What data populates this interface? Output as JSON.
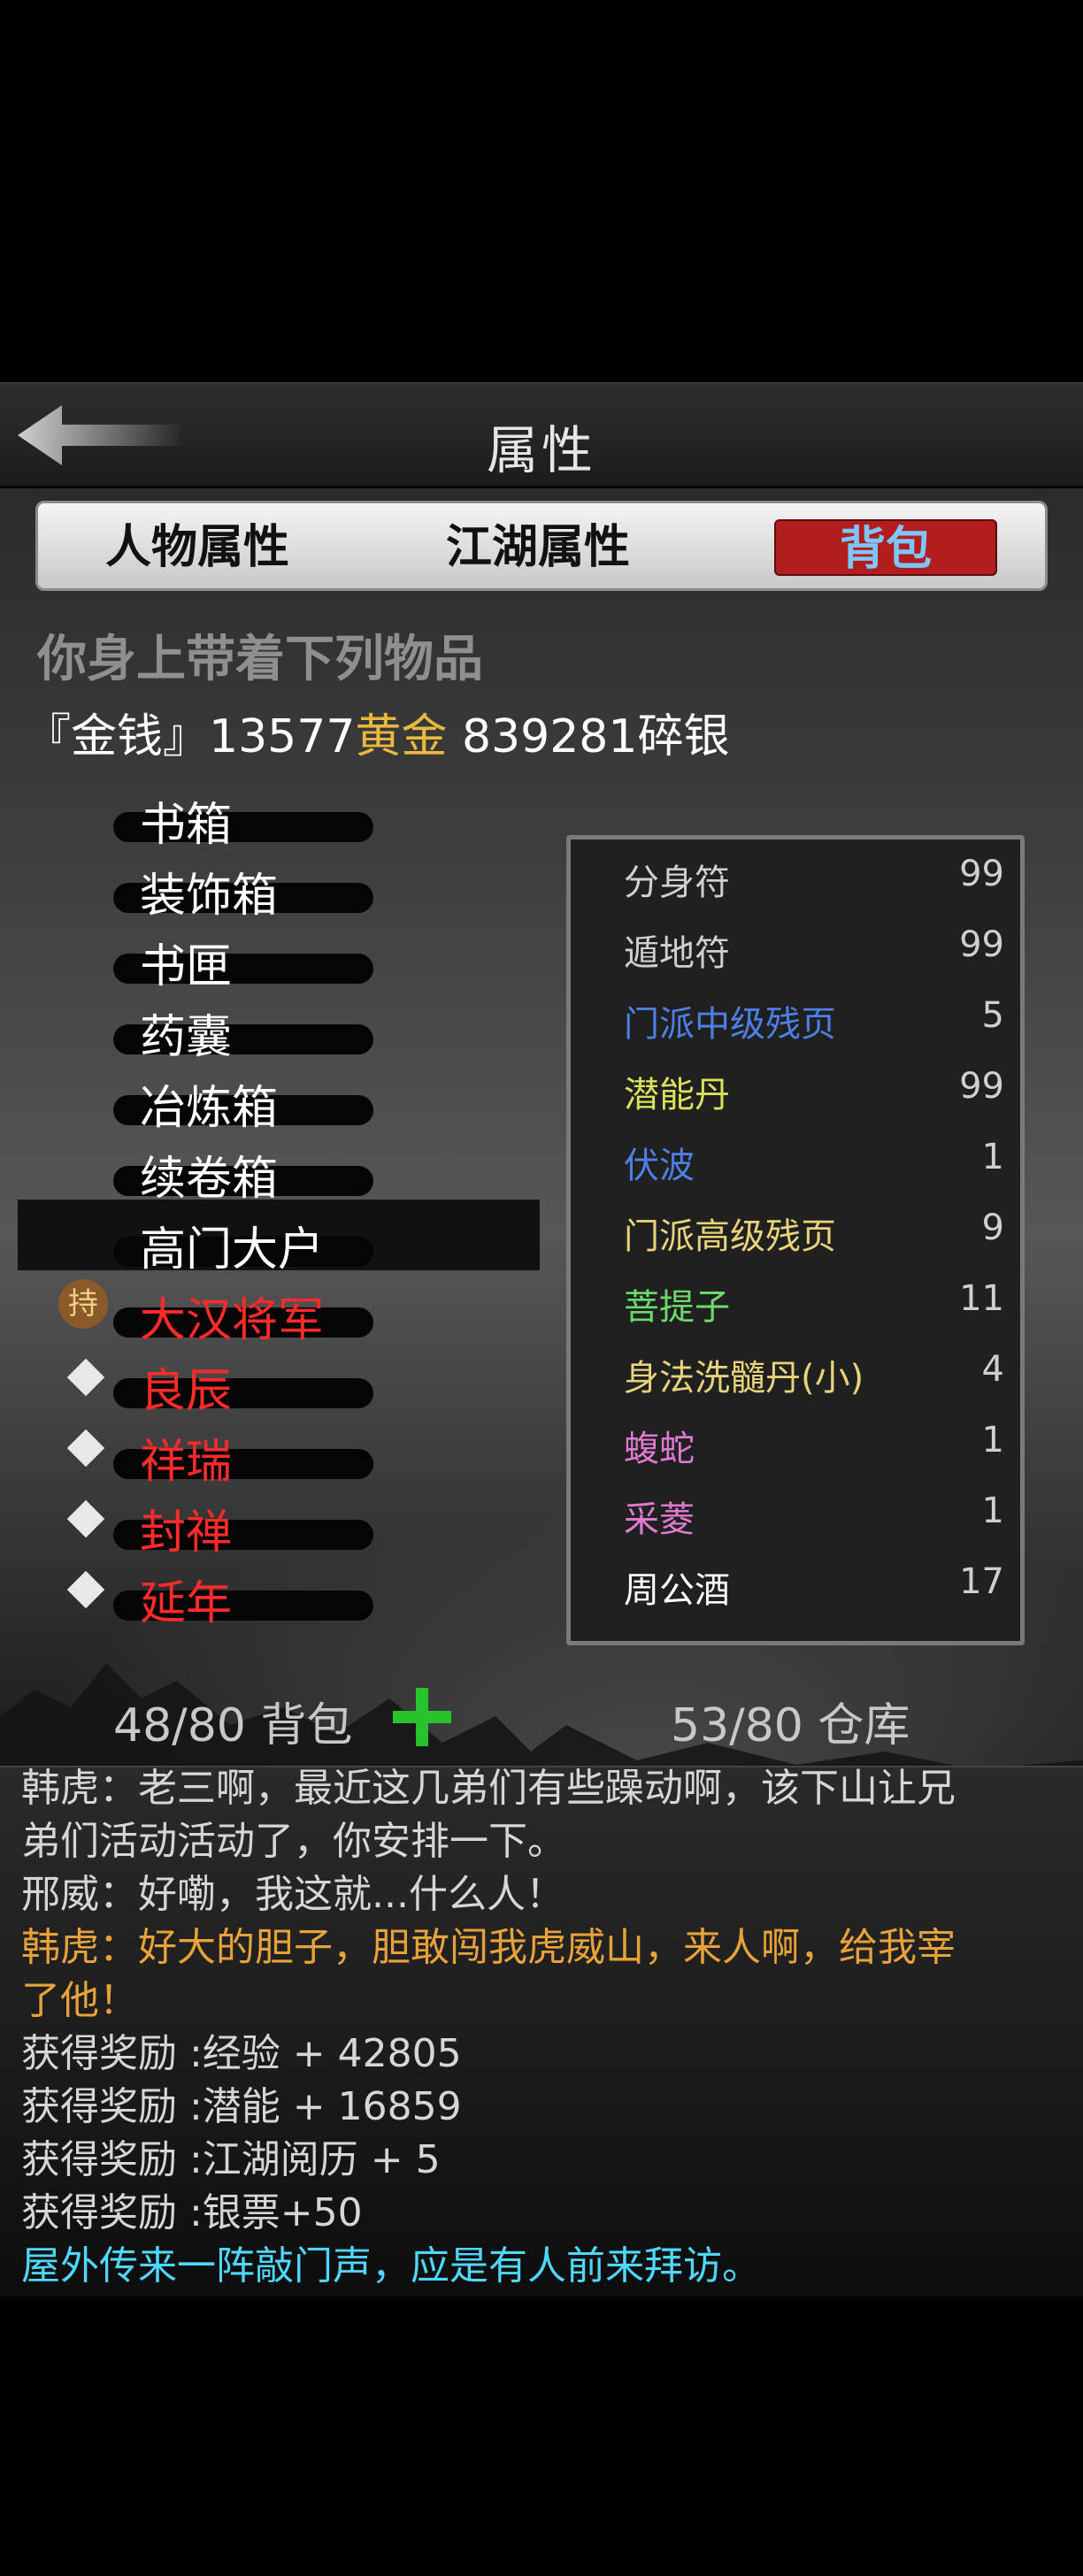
{
  "header": {
    "title": "属性",
    "back_icon": "arrow-left-icon"
  },
  "tabs": [
    {
      "label": "人物属性",
      "active": false
    },
    {
      "label": "江湖属性",
      "active": false
    },
    {
      "label": "背包",
      "active": true
    }
  ],
  "inventory": {
    "heading": "你身上带着下列物品",
    "money": {
      "prefix": "『金钱』13577",
      "gold_label": "黄金",
      "suffix": " 839281碎银"
    },
    "hold_badge": "持",
    "categories": [
      {
        "label": "书箱",
        "color": "#ffffff"
      },
      {
        "label": "装饰箱",
        "color": "#ffffff"
      },
      {
        "label": "书匣",
        "color": "#ffffff"
      },
      {
        "label": "药囊",
        "color": "#ffffff"
      },
      {
        "label": "冶炼箱",
        "color": "#ffffff"
      },
      {
        "label": "续卷箱",
        "color": "#ffffff"
      },
      {
        "label": "高门大户",
        "color": "#ffffff",
        "selected": true
      },
      {
        "label": "大汉将军",
        "color": "#ff2a2a",
        "held": true
      },
      {
        "label": "良辰",
        "color": "#ff2a2a"
      },
      {
        "label": "祥瑞",
        "color": "#ff2a2a"
      },
      {
        "label": "封禅",
        "color": "#ff2a2a"
      },
      {
        "label": "延年",
        "color": "#ff2a2a"
      }
    ],
    "items": [
      {
        "name": "分身符",
        "qty": "99",
        "color": "#d0d0d0"
      },
      {
        "name": "遁地符",
        "qty": "99",
        "color": "#d0d0d0"
      },
      {
        "name": "门派中级残页",
        "qty": "5",
        "color": "#4d7fe6"
      },
      {
        "name": "潜能丹",
        "qty": "99",
        "color": "#d8e25a"
      },
      {
        "name": "伏波",
        "qty": "1",
        "color": "#4d7fe6"
      },
      {
        "name": "门派高级残页",
        "qty": "9",
        "color": "#e8d27a"
      },
      {
        "name": "菩提子",
        "qty": "11",
        "color": "#6bdc6b"
      },
      {
        "name": "身法洗髓丹(小)",
        "qty": "4",
        "color": "#e8d27a"
      },
      {
        "name": "蝮蛇",
        "qty": "1",
        "color": "#e07ad0"
      },
      {
        "name": "采菱",
        "qty": "1",
        "color": "#e07ad0"
      },
      {
        "name": "周公酒",
        "qty": "17",
        "color": "#ffffff"
      }
    ],
    "bag_count": "48/80 背包",
    "storage_count": "53/80 仓库"
  },
  "log": [
    {
      "text": "韩虎：老三啊，最近这几弟们有些躁动啊，该下山让兄",
      "color": "c-white"
    },
    {
      "text": "弟们活动活动了，你安排一下。",
      "color": "c-white"
    },
    {
      "text": "邢威：好嘞，我这就...什么人！",
      "color": "c-white"
    },
    {
      "text": "韩虎：好大的胆子，胆敢闯我虎威山，来人啊，给我宰",
      "color": "c-orange"
    },
    {
      "text": "了他！",
      "color": "c-orange"
    },
    {
      "text": "获得奖励 :经验 + 42805",
      "color": "c-white"
    },
    {
      "text": "获得奖励 :潜能 + 16859",
      "color": "c-white"
    },
    {
      "text": "获得奖励 :江湖阅历 + 5",
      "color": "c-white"
    },
    {
      "text": "获得奖励 :银票+50",
      "color": "c-white"
    },
    {
      "text": "屋外传来一阵敲门声，应是有人前来拜访。",
      "color": "c-cyan"
    }
  ]
}
